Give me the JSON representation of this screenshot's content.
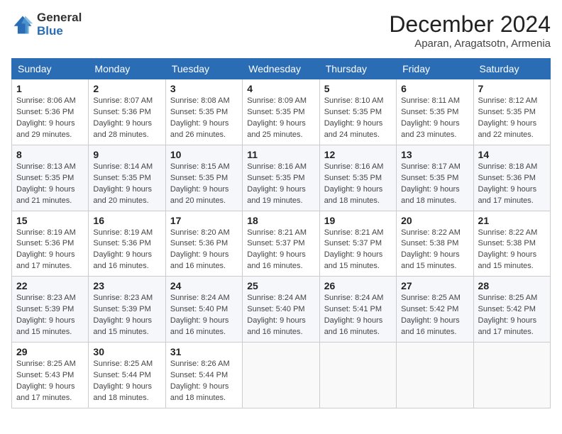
{
  "logo": {
    "general": "General",
    "blue": "Blue"
  },
  "header": {
    "month": "December 2024",
    "location": "Aparan, Aragatsotn, Armenia"
  },
  "weekdays": [
    "Sunday",
    "Monday",
    "Tuesday",
    "Wednesday",
    "Thursday",
    "Friday",
    "Saturday"
  ],
  "weeks": [
    [
      {
        "day": "1",
        "sunrise": "8:06 AM",
        "sunset": "5:36 PM",
        "daylight": "9 hours and 29 minutes."
      },
      {
        "day": "2",
        "sunrise": "8:07 AM",
        "sunset": "5:36 PM",
        "daylight": "9 hours and 28 minutes."
      },
      {
        "day": "3",
        "sunrise": "8:08 AM",
        "sunset": "5:35 PM",
        "daylight": "9 hours and 26 minutes."
      },
      {
        "day": "4",
        "sunrise": "8:09 AM",
        "sunset": "5:35 PM",
        "daylight": "9 hours and 25 minutes."
      },
      {
        "day": "5",
        "sunrise": "8:10 AM",
        "sunset": "5:35 PM",
        "daylight": "9 hours and 24 minutes."
      },
      {
        "day": "6",
        "sunrise": "8:11 AM",
        "sunset": "5:35 PM",
        "daylight": "9 hours and 23 minutes."
      },
      {
        "day": "7",
        "sunrise": "8:12 AM",
        "sunset": "5:35 PM",
        "daylight": "9 hours and 22 minutes."
      }
    ],
    [
      {
        "day": "8",
        "sunrise": "8:13 AM",
        "sunset": "5:35 PM",
        "daylight": "9 hours and 21 minutes."
      },
      {
        "day": "9",
        "sunrise": "8:14 AM",
        "sunset": "5:35 PM",
        "daylight": "9 hours and 20 minutes."
      },
      {
        "day": "10",
        "sunrise": "8:15 AM",
        "sunset": "5:35 PM",
        "daylight": "9 hours and 20 minutes."
      },
      {
        "day": "11",
        "sunrise": "8:16 AM",
        "sunset": "5:35 PM",
        "daylight": "9 hours and 19 minutes."
      },
      {
        "day": "12",
        "sunrise": "8:16 AM",
        "sunset": "5:35 PM",
        "daylight": "9 hours and 18 minutes."
      },
      {
        "day": "13",
        "sunrise": "8:17 AM",
        "sunset": "5:35 PM",
        "daylight": "9 hours and 18 minutes."
      },
      {
        "day": "14",
        "sunrise": "8:18 AM",
        "sunset": "5:36 PM",
        "daylight": "9 hours and 17 minutes."
      }
    ],
    [
      {
        "day": "15",
        "sunrise": "8:19 AM",
        "sunset": "5:36 PM",
        "daylight": "9 hours and 17 minutes."
      },
      {
        "day": "16",
        "sunrise": "8:19 AM",
        "sunset": "5:36 PM",
        "daylight": "9 hours and 16 minutes."
      },
      {
        "day": "17",
        "sunrise": "8:20 AM",
        "sunset": "5:36 PM",
        "daylight": "9 hours and 16 minutes."
      },
      {
        "day": "18",
        "sunrise": "8:21 AM",
        "sunset": "5:37 PM",
        "daylight": "9 hours and 16 minutes."
      },
      {
        "day": "19",
        "sunrise": "8:21 AM",
        "sunset": "5:37 PM",
        "daylight": "9 hours and 15 minutes."
      },
      {
        "day": "20",
        "sunrise": "8:22 AM",
        "sunset": "5:38 PM",
        "daylight": "9 hours and 15 minutes."
      },
      {
        "day": "21",
        "sunrise": "8:22 AM",
        "sunset": "5:38 PM",
        "daylight": "9 hours and 15 minutes."
      }
    ],
    [
      {
        "day": "22",
        "sunrise": "8:23 AM",
        "sunset": "5:39 PM",
        "daylight": "9 hours and 15 minutes."
      },
      {
        "day": "23",
        "sunrise": "8:23 AM",
        "sunset": "5:39 PM",
        "daylight": "9 hours and 15 minutes."
      },
      {
        "day": "24",
        "sunrise": "8:24 AM",
        "sunset": "5:40 PM",
        "daylight": "9 hours and 16 minutes."
      },
      {
        "day": "25",
        "sunrise": "8:24 AM",
        "sunset": "5:40 PM",
        "daylight": "9 hours and 16 minutes."
      },
      {
        "day": "26",
        "sunrise": "8:24 AM",
        "sunset": "5:41 PM",
        "daylight": "9 hours and 16 minutes."
      },
      {
        "day": "27",
        "sunrise": "8:25 AM",
        "sunset": "5:42 PM",
        "daylight": "9 hours and 16 minutes."
      },
      {
        "day": "28",
        "sunrise": "8:25 AM",
        "sunset": "5:42 PM",
        "daylight": "9 hours and 17 minutes."
      }
    ],
    [
      {
        "day": "29",
        "sunrise": "8:25 AM",
        "sunset": "5:43 PM",
        "daylight": "9 hours and 17 minutes."
      },
      {
        "day": "30",
        "sunrise": "8:25 AM",
        "sunset": "5:44 PM",
        "daylight": "9 hours and 18 minutes."
      },
      {
        "day": "31",
        "sunrise": "8:26 AM",
        "sunset": "5:44 PM",
        "daylight": "9 hours and 18 minutes."
      },
      null,
      null,
      null,
      null
    ]
  ]
}
